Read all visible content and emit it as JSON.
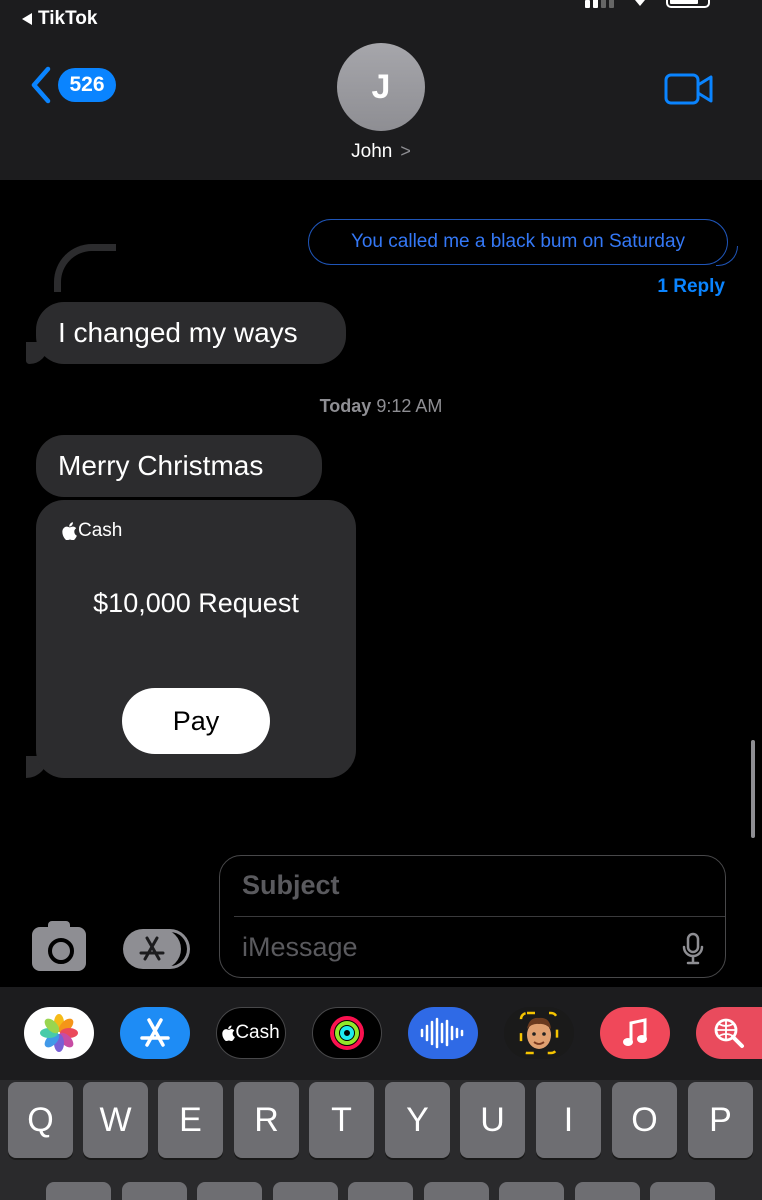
{
  "status_bar": {
    "back_app": "TikTok"
  },
  "header": {
    "back_badge": "526",
    "avatar_initial": "J",
    "contact_name": "John",
    "contact_chevron": ">"
  },
  "messages": {
    "sent_text": "You called me a black bum on Saturday",
    "reply_label": "1 Reply",
    "received_1": "I changed my ways",
    "timestamp_day": "Today",
    "timestamp_time": "9:12 AM",
    "received_2": "Merry Christmas",
    "cash_card": {
      "brand": "Cash",
      "amount_text": "$10,000 Request",
      "pay_label": "Pay"
    }
  },
  "compose": {
    "subject_placeholder": "Subject",
    "message_placeholder": "iMessage"
  },
  "app_drawer": {
    "apps": [
      "photos",
      "app-store",
      "apple-cash",
      "activity",
      "audio-message",
      "memoji",
      "music",
      "image-search"
    ],
    "cash_label": "Cash"
  },
  "keyboard": {
    "row1": [
      "Q",
      "W",
      "E",
      "R",
      "T",
      "Y",
      "U",
      "I",
      "O",
      "P"
    ]
  },
  "colors": {
    "accent_blue": "#0a84ff",
    "bubble_gray": "#2c2c2e",
    "header_bg": "#1c1c1e"
  }
}
